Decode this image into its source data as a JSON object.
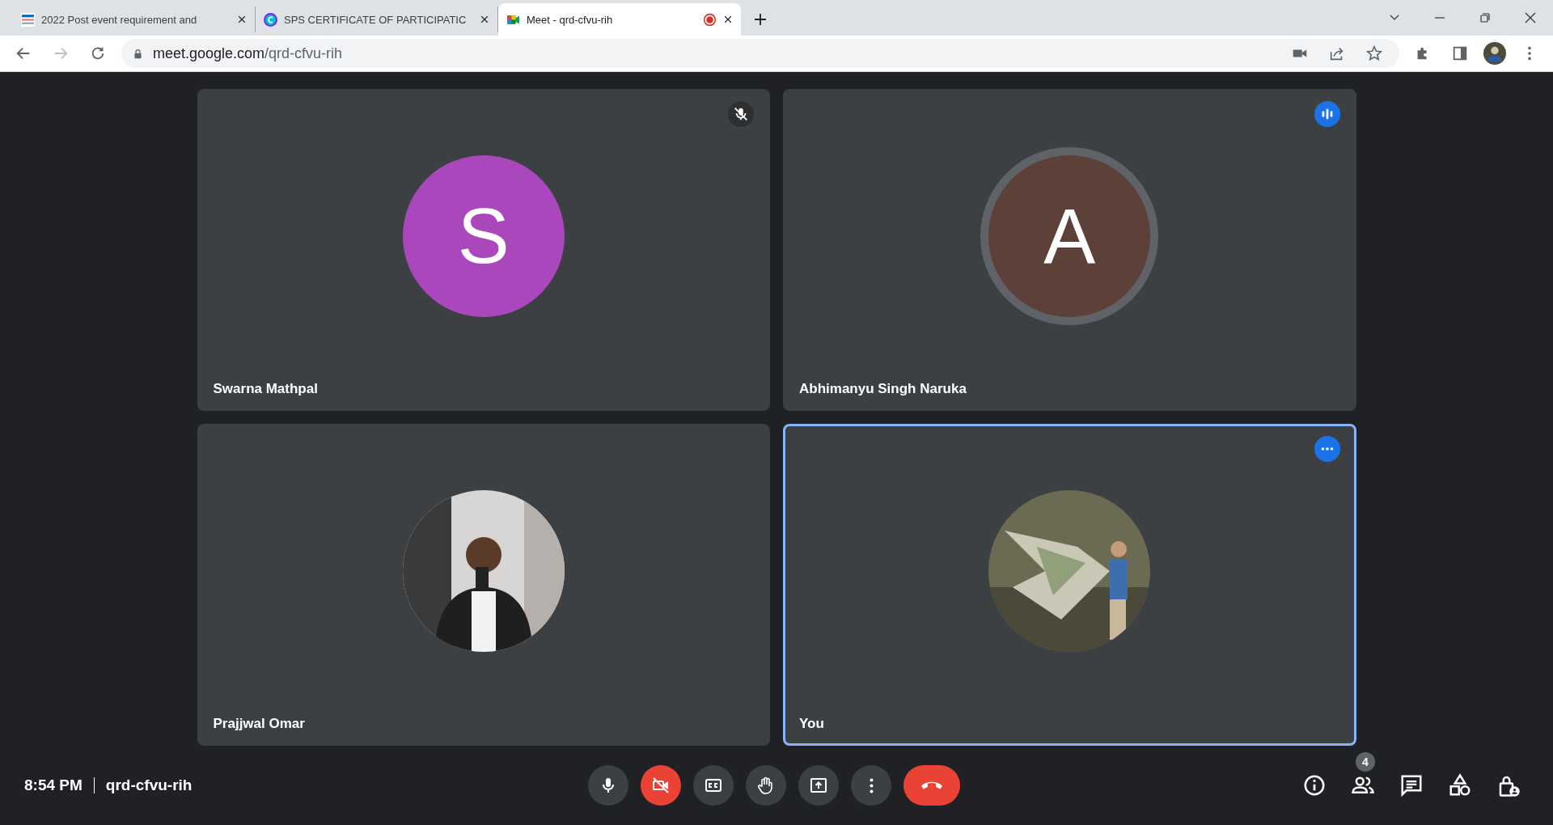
{
  "browser": {
    "tabs": [
      {
        "title": "2022 Post event requirement and",
        "selected": false,
        "recording": false
      },
      {
        "title": "SPS CERTIFICATE OF PARTICIPATIC",
        "selected": false,
        "recording": false
      },
      {
        "title": "Meet - qrd-cfvu-rih",
        "selected": true,
        "recording": true
      }
    ],
    "url_host": "meet.google.com",
    "url_path": "/qrd-cfvu-rih"
  },
  "tiles": [
    {
      "name": "Swarna Mathpal",
      "kind": "letter",
      "letter": "S",
      "color": "#ab47bc",
      "indicator": {
        "kind": "muted"
      },
      "highlighted": false
    },
    {
      "name": "Abhimanyu Singh Naruka",
      "kind": "letter",
      "letter": "A",
      "color": "#5d4037",
      "indicator": {
        "kind": "speaking"
      },
      "highlighted": false
    },
    {
      "name": "Prajjwal Omar",
      "kind": "picture",
      "highlighted": false
    },
    {
      "name": "You",
      "kind": "picture",
      "indicator": {
        "kind": "more"
      },
      "highlighted": true
    }
  ],
  "bottom": {
    "time": "8:54 PM",
    "meeting_code": "qrd-cfvu-rih",
    "controls": [
      {
        "kind": "mic",
        "alert": false
      },
      {
        "kind": "camera",
        "alert": true
      },
      {
        "kind": "captions",
        "alert": false
      },
      {
        "kind": "hand",
        "alert": false
      },
      {
        "kind": "present",
        "alert": false
      },
      {
        "kind": "more",
        "alert": false
      },
      {
        "kind": "hangup",
        "alert": true
      }
    ],
    "side": [
      {
        "kind": "info"
      },
      {
        "kind": "people",
        "badge": "4"
      },
      {
        "kind": "chat"
      },
      {
        "kind": "activities"
      },
      {
        "kind": "lock"
      }
    ]
  }
}
